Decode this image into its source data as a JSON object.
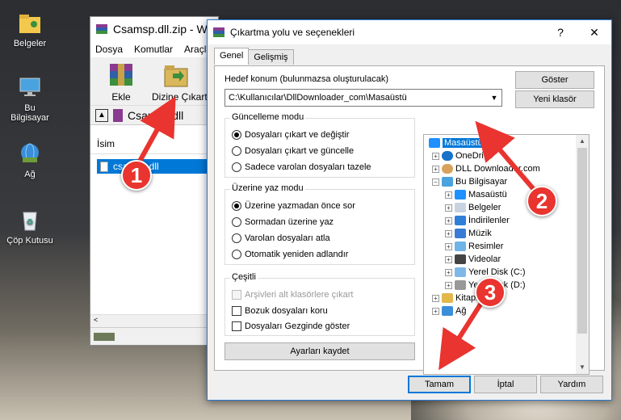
{
  "desktop": {
    "icons": [
      {
        "label": "Belgeler",
        "icon": "user-folder-icon"
      },
      {
        "label": "Bu Bilgisayar",
        "icon": "computer-icon"
      },
      {
        "label": "Ağ",
        "icon": "network-icon"
      },
      {
        "label": "Çöp Kutusu",
        "icon": "recycle-bin-icon"
      }
    ]
  },
  "winrar": {
    "title": "Csamsp.dll.zip - Wi",
    "menu": [
      "Dosya",
      "Komutlar",
      "Araçla"
    ],
    "toolbar": {
      "add_label": "Ekle",
      "extract_label": "Dizine Çıkart"
    },
    "address": "Csamsp.dll",
    "list_header": "İsim",
    "file_name": "csamsp.dll"
  },
  "dialog": {
    "title": "Çıkartma yolu ve seçenekleri",
    "help_button": "?",
    "close_button": "✕",
    "tabs": [
      "Genel",
      "Gelişmiş"
    ],
    "destination_label": "Hedef konum (bulunmazsa oluşturulacak)",
    "destination_value": "C:\\Kullanıcılar\\DllDownloader_com\\Masaüstü",
    "show_button": "Göster",
    "new_folder_button": "Yeni klasör",
    "update_mode": {
      "title": "Güncelleme modu",
      "options": [
        "Dosyaları çıkart ve değiştir",
        "Dosyaları çıkart ve güncelle",
        "Sadece varolan dosyaları tazele"
      ],
      "selected": 0
    },
    "overwrite_mode": {
      "title": "Üzerine yaz modu",
      "options": [
        "Üzerine yazmadan önce sor",
        "Sormadan üzerine yaz",
        "Varolan dosyaları atla",
        "Otomatik yeniden adlandır"
      ],
      "selected": 0
    },
    "misc": {
      "title": "Çeşitli",
      "options": [
        "Arşivleri alt klasörlere çıkart",
        "Bozuk dosyaları koru",
        "Dosyaları Gezginde göster"
      ],
      "disabled": [
        true,
        false,
        false
      ]
    },
    "save_settings_button": "Ayarları kaydet",
    "tree": {
      "items": [
        "Masaüstü",
        "OneDrive",
        "DLL Downloader.com",
        "Bu Bilgisayar",
        "Masaüstü",
        "Belgeler",
        "İndirilenler",
        "Müzik",
        "Resimler",
        "Videolar",
        "Yerel Disk (C:)",
        "Yerel Disk (D:)",
        "Kitaplıklar",
        "Ağ"
      ],
      "selected": 0
    },
    "ok_button": "Tamam",
    "cancel_button": "İptal",
    "help_text_button": "Yardım"
  },
  "annotations": {
    "badges": [
      "1",
      "2",
      "3"
    ],
    "color": "#e9342f"
  }
}
